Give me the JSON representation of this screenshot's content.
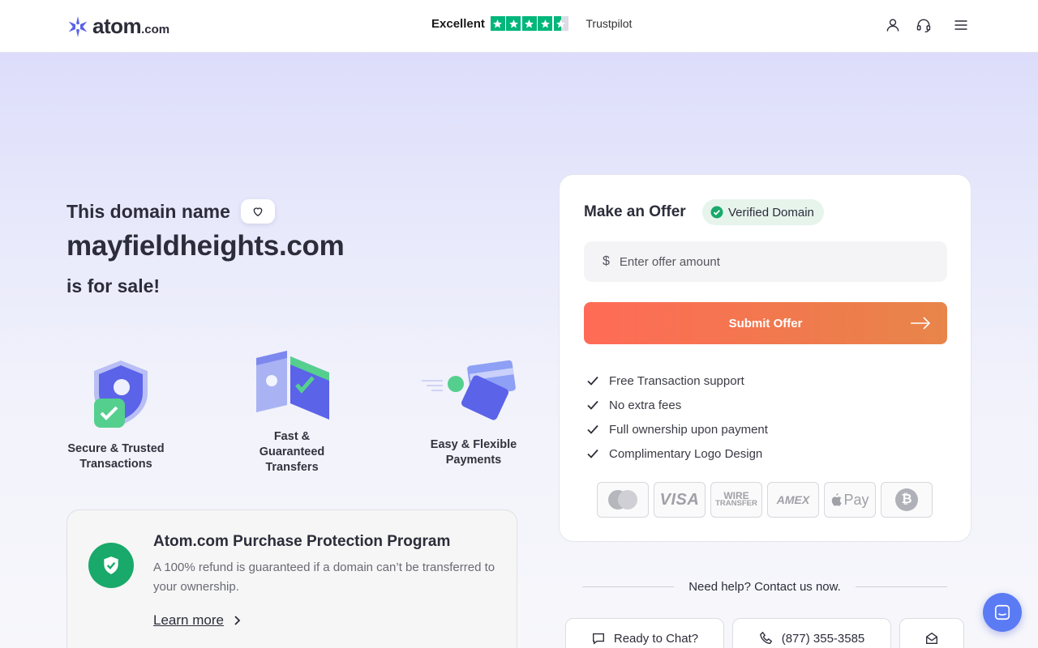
{
  "header": {
    "logo_text": "atom",
    "logo_suffix": ".com",
    "trustpilot_rating": "Excellent",
    "trustpilot_stars": 4.5,
    "trustpilot_name": "Trustpilot",
    "icons": [
      "user-icon",
      "headset-icon",
      "menu-icon"
    ]
  },
  "hero": {
    "lead": "This domain name",
    "domain": "mayfieldheights.com",
    "tail": "is for sale!"
  },
  "features": [
    {
      "label_line1": "Secure & Trusted",
      "label_line2": "Transactions",
      "icon": "shield-check-illustration"
    },
    {
      "label_line1": "Fast &",
      "label_line2": "Guaranteed",
      "label_line3": "Transfers",
      "icon": "wallet-illustration"
    },
    {
      "label_line1": "Easy & Flexible",
      "label_line2": "Payments",
      "icon": "cards-illustration"
    }
  ],
  "protection": {
    "title": "Atom.com Purchase Protection Program",
    "description": "A 100% refund is guaranteed if a domain can’t be transferred to your ownership.",
    "link": "Learn more"
  },
  "offer": {
    "title": "Make an Offer",
    "verified_label": "Verified Domain",
    "currency": "$",
    "input_placeholder": "Enter offer amount",
    "input_value": "",
    "submit_label": "Submit Offer",
    "benefits": [
      "Free Transaction support",
      "No extra fees",
      "Full ownership upon payment",
      "Complimentary Logo Design"
    ],
    "payment_methods": {
      "mastercard": "mastercard-icon",
      "visa": "VISA",
      "wire_line1": "WIRE",
      "wire_line2": "TRANSFER",
      "amex": "AMEX",
      "apple_pay": "Pay",
      "bitcoin": "₿"
    }
  },
  "help": {
    "text": "Need help? Contact us now.",
    "chat_label": "Ready to Chat?",
    "phone": "(877) 355-3585"
  },
  "colors": {
    "accent": "#ff6b57",
    "trustpilot": "#00b67a",
    "verified": "#19a96a",
    "chat_fab": "#5b7bf4"
  }
}
